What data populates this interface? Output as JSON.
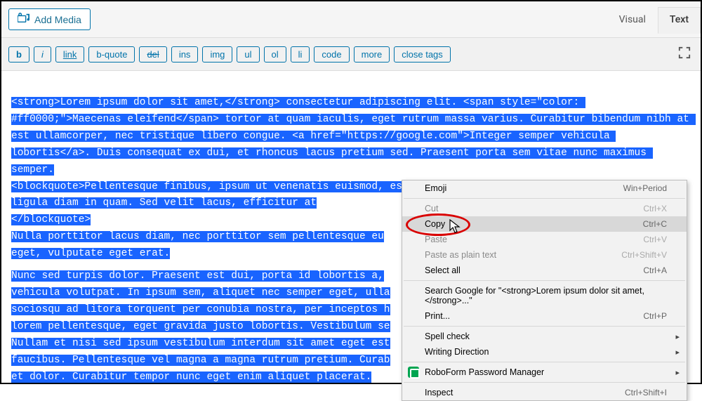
{
  "toolbar": {
    "add_media_label": "Add Media"
  },
  "tabs": {
    "visual": "Visual",
    "text": "Text"
  },
  "quicktags": {
    "b": "b",
    "i": "i",
    "link": "link",
    "bquote": "b-quote",
    "del": "del",
    "ins": "ins",
    "img": "img",
    "ul": "ul",
    "ol": "ol",
    "li": "li",
    "code": "code",
    "more": "more",
    "close": "close tags"
  },
  "editor_lines": [
    "<strong>Lorem ipsum dolor sit amet,</strong> consectetur adipiscing elit. <span style=\"color: #ff0000;\">Maecenas eleifend</span> tortor at quam iaculis, eget rutrum massa varius. Curabitur bibendum nibh at est ullamcorper, nec tristique libero congue. <a href=\"https://google.com\">Integer semper vehicula lobortis</a>. Duis consequat ex dui, et rhoncus lacus pretium sed. Praesent porta sem vitae nunc maximus semper.",
    "<blockquote>Pellentesque finibus, ipsum ut venenatis euismod, est tellus ullamcorper arcu, eget condimentum ligula diam in quam. Sed velit lacus, efficitur at",
    "</blockquote>",
    "Nulla porttitor lacus diam, nec porttitor sem pellentesque eu",
    "eget, vulputate eget erat.",
    "Nunc sed turpis dolor. Praesent est dui, porta id lobortis a,",
    "vehicula volutpat. In ipsum sem, aliquet nec semper eget, ulla",
    "sociosqu ad litora torquent per conubia nostra, per inceptos h",
    "lorem pellentesque, eget gravida justo lobortis. Vestibulum se",
    "Nullam et nisi sed ipsum vestibulum interdum sit amet eget est",
    "faucibus. Pellentesque vel magna a magna rutrum pretium. Curab",
    "et dolor. Curabitur tempor nunc eget enim aliquet placerat."
  ],
  "context_menu": {
    "emoji": "Emoji",
    "emoji_shortcut": "Win+Period",
    "cut": "Cut",
    "cut_shortcut": "Ctrl+X",
    "copy": "Copy",
    "copy_shortcut": "Ctrl+C",
    "paste": "Paste",
    "paste_shortcut": "Ctrl+V",
    "paste_plain": "Paste as plain text",
    "paste_plain_shortcut": "Ctrl+Shift+V",
    "select_all": "Select all",
    "select_all_shortcut": "Ctrl+A",
    "search": "Search Google for \"<strong>Lorem ipsum dolor sit amet,</strong>...\"",
    "print": "Print...",
    "print_shortcut": "Ctrl+P",
    "spell": "Spell check",
    "writing": "Writing Direction",
    "roboform": "RoboForm Password Manager",
    "inspect": "Inspect",
    "inspect_shortcut": "Ctrl+Shift+I"
  }
}
